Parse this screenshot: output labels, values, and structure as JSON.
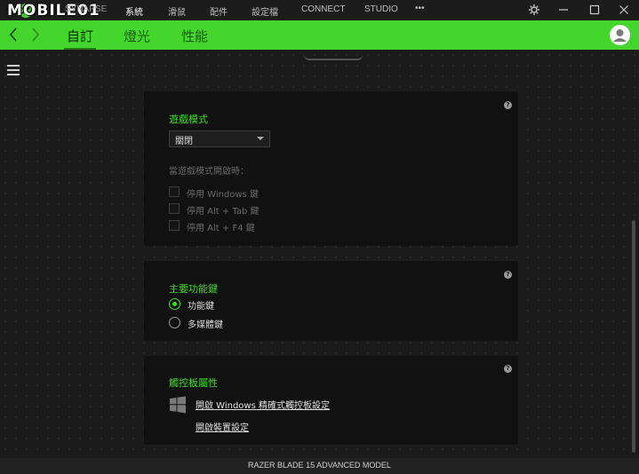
{
  "titlebar": {
    "watermark": "MOBILE01",
    "nav": [
      "SYNAPSE",
      "系統",
      "滑鼠",
      "配件",
      "設定檔",
      "CONNECT",
      "STUDIO",
      "•••"
    ]
  },
  "greenbar": {
    "tabs": [
      "自訂",
      "燈光",
      "性能"
    ],
    "active_tab": "自訂"
  },
  "game_mode": {
    "title": "遊戲模式",
    "select_value": "關閉",
    "when_on_label": "當遊戲模式開啟時：",
    "options": [
      "停用 Windows 鍵",
      "停用 Alt + Tab 鍵",
      "停用 Alt + F4 鍵"
    ]
  },
  "primary_keys": {
    "title": "主要功能鍵",
    "options": [
      "功能鍵",
      "多媒體鍵"
    ],
    "selected": "功能鍵"
  },
  "touchpad": {
    "title": "觸控板屬性",
    "link1": "開啟 Windows 精確式觸控板設定",
    "link2": "開啟裝置設定"
  },
  "help_glyph": "?",
  "footer": {
    "model": "RAZER BLADE 15 ADVANCED MODEL"
  },
  "colors": {
    "accent": "#44d62c",
    "panel": "#111111",
    "background": "#1b1b1b"
  }
}
